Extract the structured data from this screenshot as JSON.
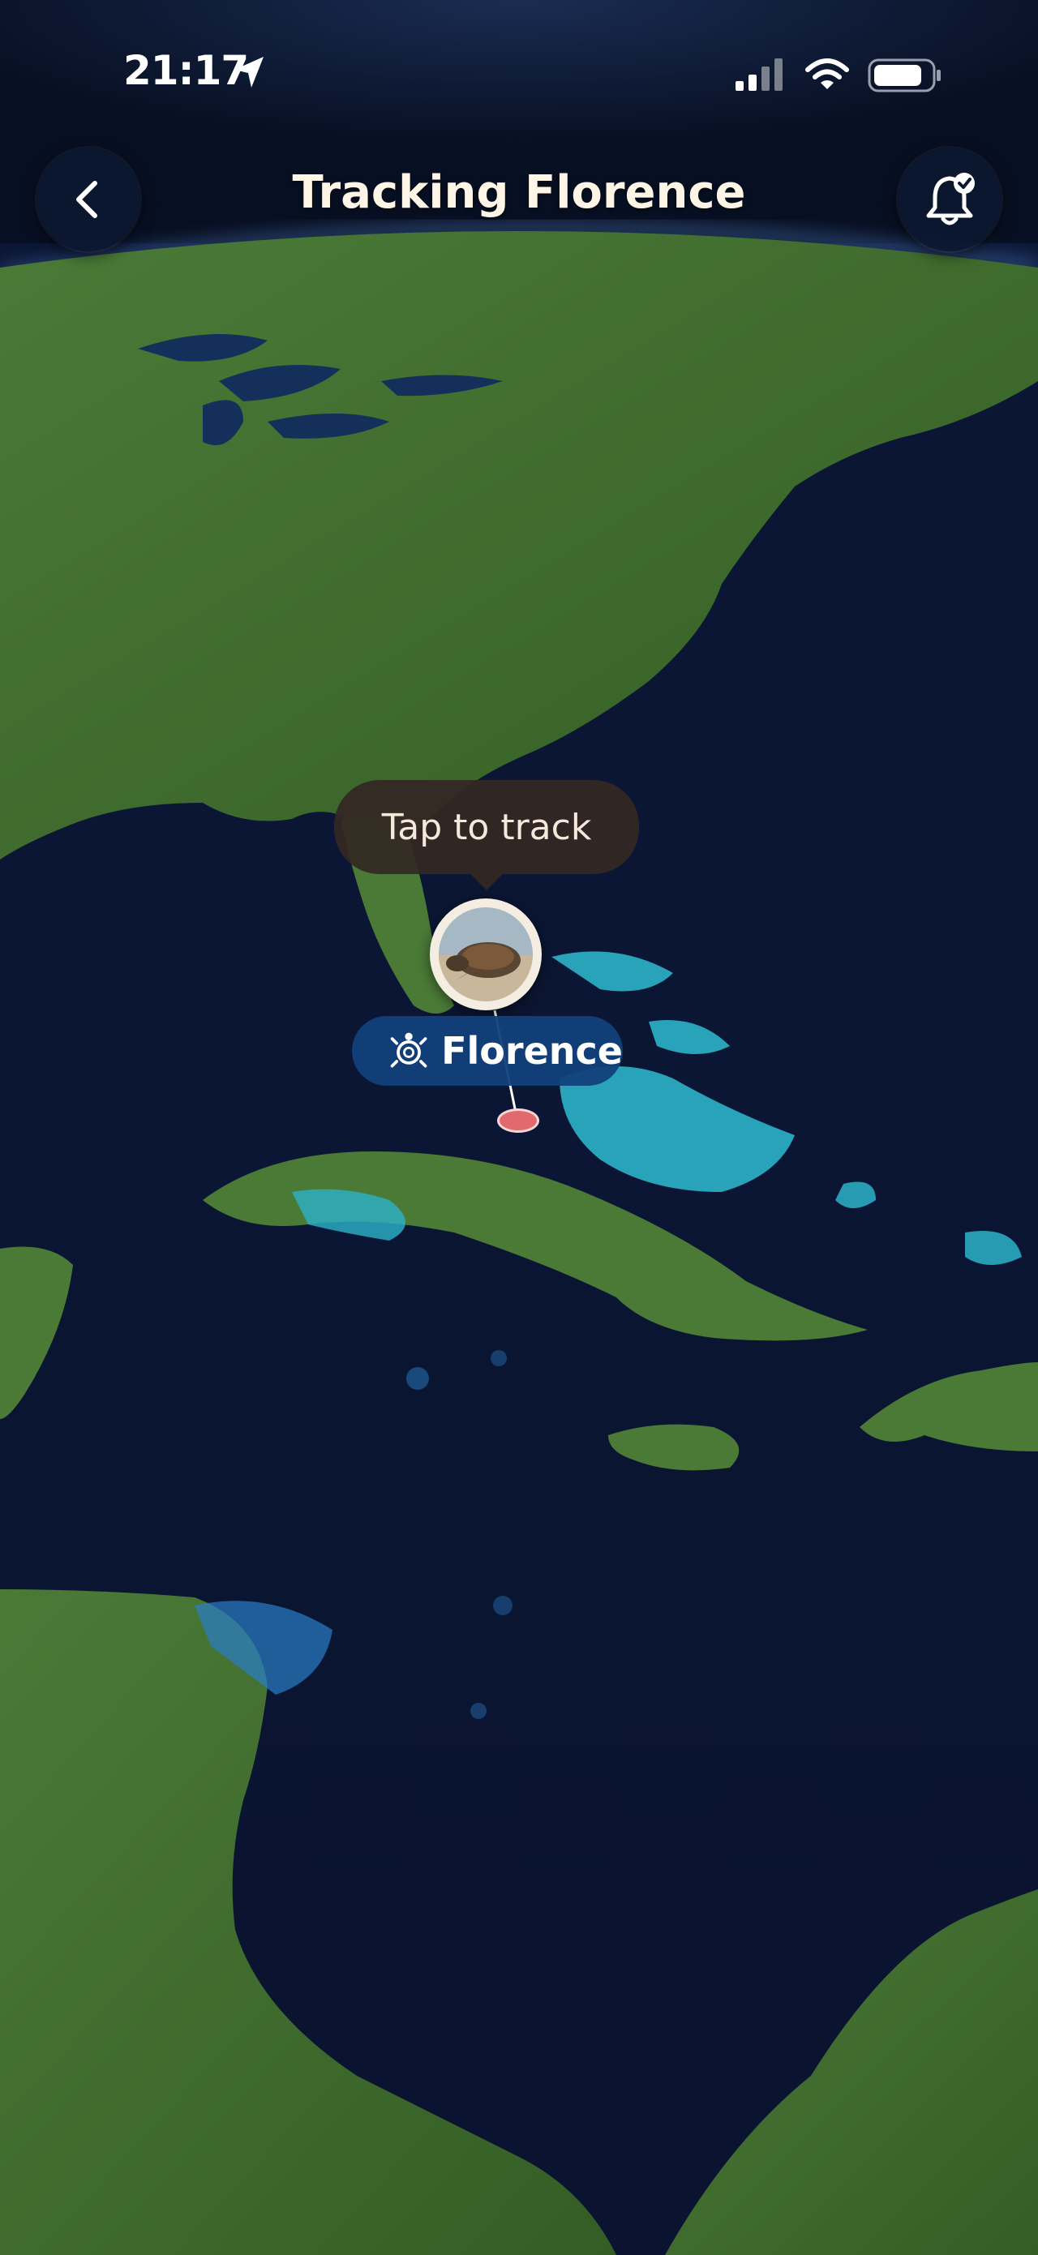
{
  "status_bar": {
    "time": "21:17",
    "icons": [
      "location-arrow-icon",
      "cellular-signal-icon",
      "wifi-icon",
      "battery-icon"
    ]
  },
  "header": {
    "title": "Tracking Florence",
    "back_icon": "chevron-left-icon",
    "alert_icon": "bell-check-icon"
  },
  "map": {
    "tooltip": "Tap to track",
    "animal": {
      "name": "Florence",
      "species_icon": "turtle-icon",
      "photo": "sea-turtle-photo"
    }
  },
  "colors": {
    "ocean": "#0a1530",
    "land": "#3f6e2c",
    "shallow_water": "#2bb3c9",
    "pill": "#12407a",
    "position_dot": "#e26a6f",
    "title": "#fff5e6"
  }
}
